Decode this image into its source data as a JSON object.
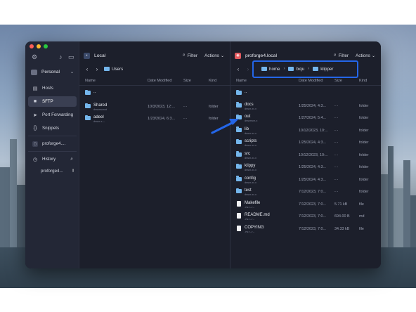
{
  "app": {
    "accent": "#2466e8"
  },
  "sidebar": {
    "vault": "Personal",
    "items": [
      {
        "label": "Hosts",
        "icon": "server-icon"
      },
      {
        "label": "SFTP",
        "icon": "folder-icon",
        "active": true
      },
      {
        "label": "Port Forwarding",
        "icon": "arrow-right-icon"
      },
      {
        "label": "Snippets",
        "icon": "code-braces-icon"
      },
      {
        "label": "proforge4....",
        "icon": "host-icon"
      },
      {
        "label": "History",
        "icon": "clock-icon"
      }
    ],
    "history_item": "proforge4...",
    "history_badge": "!"
  },
  "local": {
    "host": "Local",
    "filter": "Filter",
    "actions": "Actions",
    "path": [
      "Users"
    ],
    "columns": {
      "name": "Name",
      "modified": "Date Modified",
      "size": "Size",
      "kind": "Kind"
    },
    "rows": [
      {
        "name": "..",
        "sub": "",
        "modified": "",
        "size": "",
        "kind": ""
      },
      {
        "name": "Shared",
        "sub": "drwxrwxrwt",
        "modified": "10/3/2023, 12:...",
        "size": "- -",
        "kind": "folder"
      },
      {
        "name": "adeel",
        "sub": "drwxr-x---",
        "modified": "1/23/2024, 6:3...",
        "size": "- -",
        "kind": "folder"
      }
    ]
  },
  "remote": {
    "host": "proforge4.local",
    "filter": "Filter",
    "actions": "Actions",
    "path": [
      "home",
      "biqu",
      "klipper"
    ],
    "columns": {
      "name": "Name",
      "modified": "Date Modified",
      "size": "Size",
      "kind": "Kind"
    },
    "rows": [
      {
        "name": "..",
        "sub": "",
        "modified": "",
        "size": "",
        "kind": "",
        "type": "folder"
      },
      {
        "name": "docs",
        "sub": "drwxr-xr-x",
        "modified": "1/25/2024, 4:3...",
        "size": "- -",
        "kind": "folder",
        "type": "folder"
      },
      {
        "name": "out",
        "sub": "drwxrwxr-x",
        "modified": "1/27/2024, 5:4...",
        "size": "- -",
        "kind": "folder",
        "type": "folder"
      },
      {
        "name": "lib",
        "sub": "drwxr-xr-x",
        "modified": "10/12/2023, 10:...",
        "size": "- -",
        "kind": "folder",
        "type": "folder"
      },
      {
        "name": "scripts",
        "sub": "drwxr-xr-x",
        "modified": "1/25/2024, 4:3...",
        "size": "- -",
        "kind": "folder",
        "type": "folder"
      },
      {
        "name": "src",
        "sub": "drwxr-xr-x",
        "modified": "10/12/2023, 10:...",
        "size": "- -",
        "kind": "folder",
        "type": "folder"
      },
      {
        "name": "klippy",
        "sub": "drwxr-xr-x",
        "modified": "1/25/2024, 4:3...",
        "size": "- -",
        "kind": "folder",
        "type": "folder"
      },
      {
        "name": "config",
        "sub": "drwxr-xr-x",
        "modified": "1/25/2024, 4:3...",
        "size": "- -",
        "kind": "folder",
        "type": "folder"
      },
      {
        "name": "test",
        "sub": "drwxr-xr-x",
        "modified": "7/12/2023, 7:0...",
        "size": "- -",
        "kind": "folder",
        "type": "folder"
      },
      {
        "name": "Makefile",
        "sub": "-rw-r--r--",
        "modified": "7/12/2023, 7:0...",
        "size": "5.71 kB",
        "kind": "file",
        "type": "file"
      },
      {
        "name": "README.md",
        "sub": "-rw-r--r--",
        "modified": "7/12/2023, 7:0...",
        "size": "694.00 B",
        "kind": "md",
        "type": "file"
      },
      {
        "name": "COPYING",
        "sub": "-rw-r--r--",
        "modified": "7/12/2023, 7:0...",
        "size": "34.33 kB",
        "kind": "file",
        "type": "file"
      }
    ]
  }
}
